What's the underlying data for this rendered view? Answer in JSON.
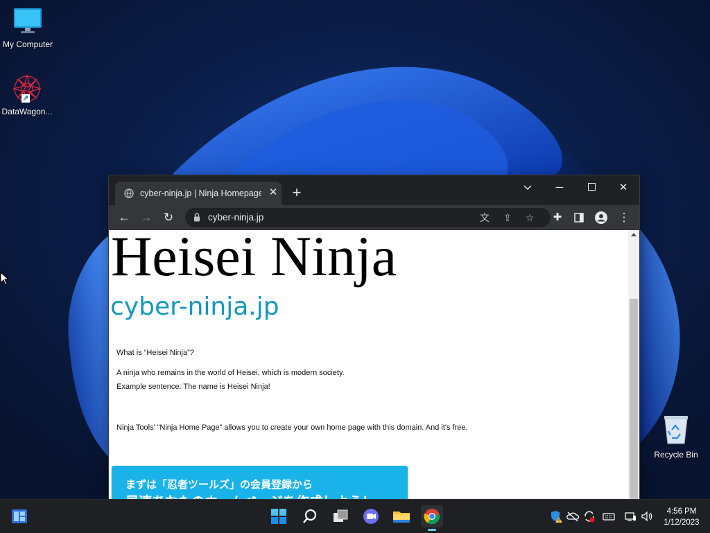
{
  "desktop": {
    "icons": [
      {
        "label": "My Computer"
      },
      {
        "label": "DataWagon..."
      },
      {
        "label": "Recycle Bin"
      }
    ]
  },
  "browser": {
    "tab_title": "cyber-ninja.jp | Ninja Homepage",
    "url": "cyber-ninja.jp",
    "page": {
      "heading": "Heisei Ninja",
      "domain": "cyber-ninja.jp",
      "q": "What is “Heisei Ninja”?",
      "answer1": "A ninja who remains in the world of Heisei, which is modern society.",
      "answer2": "Example sentence: The name is Heisei Ninja!",
      "tools_text": "Ninja Tools' “Ninja Home Page” allows you to create your own home page with this domain. And it's free.",
      "banner_line1": "まずは「忍者ツールズ」の会員登録から",
      "banner_line2": "早速あなたのホームページを作成しよう！"
    }
  },
  "taskbar": {
    "time": "4:56 PM",
    "date": "1/12/2023"
  },
  "colors": {
    "accent": "#60cdff",
    "domain_text": "#1597c1",
    "banner": "#19b3ea"
  }
}
